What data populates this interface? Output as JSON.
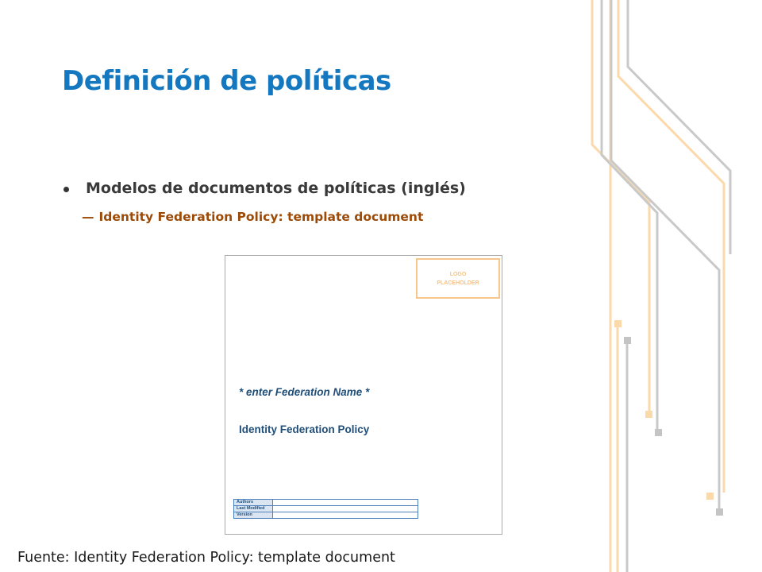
{
  "slide": {
    "title": "Definición de políticas",
    "bullet": "Modelos de documentos de políticas (inglés)",
    "sub_dash": "—",
    "sub_item": "Identity Federation Policy: template document",
    "source": "Fuente: Identity Federation Policy: template document"
  },
  "document_thumbnail": {
    "logo_line1": "LOGO",
    "logo_line2": "PLACEHOLDER",
    "federation_name": "* enter Federation Name *",
    "doc_title": "Identity Federation Policy",
    "table_rows": [
      {
        "label": "Authors",
        "value": ""
      },
      {
        "label": "Last Modified",
        "value": ""
      },
      {
        "label": "Version",
        "value": ""
      }
    ]
  },
  "colors": {
    "title": "#1478c0",
    "sub_item": "#9c4a06",
    "deco_gray": "#c4c4c4",
    "deco_orange": "#fbd9ab"
  }
}
